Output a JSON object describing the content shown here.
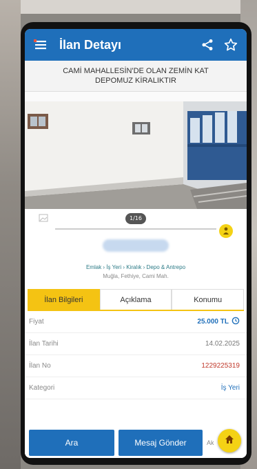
{
  "header": {
    "title": "İlan Detayı",
    "menu_icon": "menu-icon",
    "share_icon": "share-icon",
    "favorite_icon": "star-icon",
    "color": "#1f6fba"
  },
  "listing": {
    "title_line1": "CAMİ MAHALLESİN'DE OLAN ZEMİN KAT",
    "title_line2": "DEPOMUZ KİRALIKTIR",
    "photo_counter": "1/16",
    "breadcrumb": "Emlak › İş Yeri › Kiralık › Depo & Antrepo",
    "location": "Muğla, Fethiye, Cami Mah."
  },
  "tabs": [
    {
      "label": "İlan Bilgileri",
      "active": true
    },
    {
      "label": "Açıklama",
      "active": false
    },
    {
      "label": "Konumu",
      "active": false
    }
  ],
  "info": [
    {
      "label": "Fiyat",
      "value": "25.000 TL"
    },
    {
      "label": "İlan Tarihi",
      "value": "14.02.2025"
    },
    {
      "label": "İlan No",
      "value": "1229225319"
    },
    {
      "label": "Kategori",
      "value": "İş Yeri"
    }
  ],
  "bottom": {
    "call_label": "Ara",
    "message_label": "Mesaj Gönder",
    "more_label": "Ak"
  },
  "accent": "#f4c313"
}
